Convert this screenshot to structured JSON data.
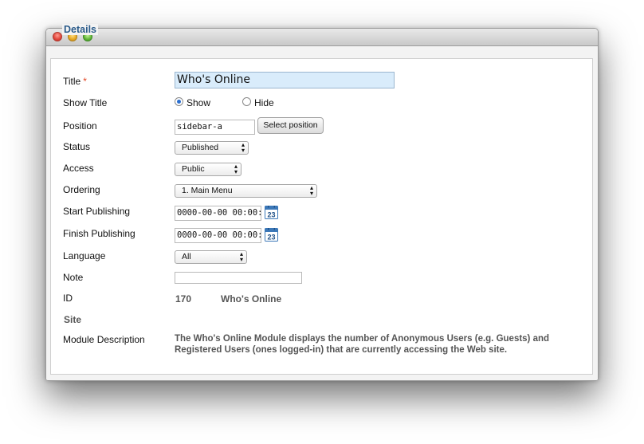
{
  "window": {
    "controls": [
      "close",
      "minimize",
      "zoom"
    ]
  },
  "section": {
    "legend": "Details"
  },
  "form": {
    "title": {
      "label": "Title",
      "required_mark": "*",
      "value": "Who's Online"
    },
    "show_title": {
      "label": "Show Title",
      "options": [
        "Show",
        "Hide"
      ],
      "selected": "Show"
    },
    "position": {
      "label": "Position",
      "value": "sidebar-a",
      "button": "Select position"
    },
    "status": {
      "label": "Status",
      "value": "Published"
    },
    "access": {
      "label": "Access",
      "value": "Public"
    },
    "ordering": {
      "label": "Ordering",
      "value": "1. Main Menu"
    },
    "start_publishing": {
      "label": "Start Publishing",
      "value": "0000-00-00 00:00:0",
      "calendar_day": "23"
    },
    "finish_publishing": {
      "label": "Finish Publishing",
      "value": "0000-00-00 00:00:0",
      "calendar_day": "23"
    },
    "language": {
      "label": "Language",
      "value": "All"
    },
    "note": {
      "label": "Note",
      "value": ""
    },
    "id": {
      "label": "ID",
      "value": "170",
      "module_name": "Who's Online"
    },
    "site": {
      "label": "Site"
    },
    "description": {
      "label": "Module Description",
      "line1": "The Who's Online Module displays the number of Anonymous Users (e.g. Guests) and",
      "line2": "Registered Users (ones logged-in) that are currently accessing the Web site."
    }
  },
  "colors": {
    "legend": "#2b5b8a",
    "required": "#e2421f",
    "title_field_bg": "#d9ecfb"
  }
}
